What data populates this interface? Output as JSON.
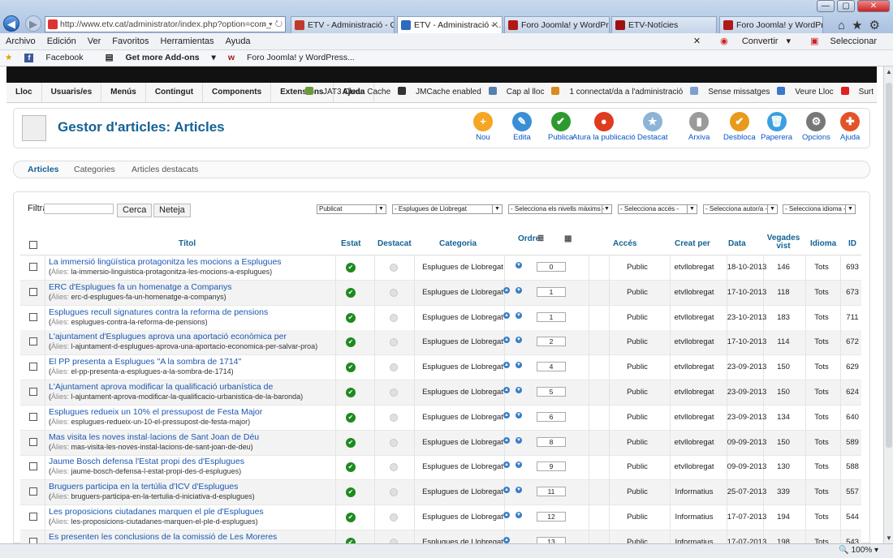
{
  "browser": {
    "address": "http://www.etv.cat/administrator/index.php?option=com_",
    "tabs": [
      {
        "label": "ETV - Administració - Ges...",
        "color": "#c0392b",
        "active": false
      },
      {
        "label": "ETV - Administració - ...",
        "color": "#2b6bc0",
        "active": true
      },
      {
        "label": "Foro Joomla! y WordPress...",
        "color": "#b01818",
        "active": false
      },
      {
        "label": "ETV-Notícies",
        "color": "#a01010",
        "active": false
      },
      {
        "label": "Foro Joomla! y WordPress...",
        "color": "#b01818",
        "active": false
      }
    ],
    "menu": [
      "Archivo",
      "Edición",
      "Ver",
      "Favoritos",
      "Herramientas",
      "Ayuda"
    ],
    "menu_right": [
      "Convertir",
      "Seleccionar"
    ],
    "favorites": [
      "Facebook",
      "Get more Add-ons",
      "Foro Joomla! y WordPress..."
    ],
    "zoom": "100%"
  },
  "admin_menu": {
    "left": [
      "Lloc",
      "Usuaris/es",
      "Menús",
      "Contingut",
      "Components",
      "Extensions",
      "Ajuda"
    ],
    "right": [
      {
        "label": "JAT3 Clean Cache",
        "color": "#6a9a3a"
      },
      {
        "label": "JMCache enabled",
        "color": "#333"
      },
      {
        "label": "Cap al lloc",
        "color": "#5580aa"
      },
      {
        "label": "1 connectat/da a l'administració",
        "color": "#d98c1c"
      },
      {
        "label": "Sense missatges",
        "color": "#7d9fd0"
      },
      {
        "label": "Veure Lloc",
        "color": "#3a78c8"
      },
      {
        "label": "Surt",
        "color": "#d22"
      }
    ]
  },
  "page_title": "Gestor d'articles: Articles",
  "toolbar": [
    {
      "label": "Nou",
      "color": "#f5a623",
      "glyph": "+",
      "icon": "plus-icon"
    },
    {
      "label": "Edita",
      "color": "#3a8ed6",
      "glyph": "✎",
      "icon": "pencil-icon"
    },
    {
      "label": "Publica",
      "color": "#2e9a2e",
      "glyph": "✔",
      "icon": "check-icon"
    },
    {
      "label": "Atura la publicació",
      "color": "#e03a1f",
      "glyph": "●",
      "icon": "stop-icon"
    },
    {
      "label": "Destacat",
      "color": "#8cb4d6",
      "glyph": "★",
      "icon": "featured-icon"
    },
    {
      "label": "Arxiva",
      "color": "#9a9a9a",
      "glyph": "▮",
      "icon": "archive-icon"
    },
    {
      "label": "Desbloca",
      "color": "#e89a1c",
      "glyph": "✔",
      "icon": "checkin-icon"
    },
    {
      "label": "Paperera",
      "color": "#3aa0e0",
      "glyph": "🗑",
      "icon": "trash-icon"
    },
    {
      "label": "Opcions",
      "color": "#777",
      "glyph": "⚙",
      "icon": "options-icon"
    },
    {
      "label": "Ajuda",
      "color": "#e2532a",
      "glyph": "✚",
      "icon": "help-icon"
    }
  ],
  "subnav": [
    "Articles",
    "Categories",
    "Articles destacats"
  ],
  "filters": {
    "label": "Filtra",
    "search_button": "Cerca",
    "clear_button": "Neteja",
    "selects": [
      "Publicat",
      "- Esplugues de Llobregat",
      "- Selecciona els nivells màxims -",
      "- Selecciona accés -",
      "- Selecciona autor/a -",
      "- Selecciona idioma -"
    ]
  },
  "table": {
    "headers": {
      "title": "Títol",
      "status": "Estat",
      "featured": "Destacat",
      "category": "Categoria",
      "order": "Ordre",
      "access": "Accés",
      "author": "Creat per",
      "date": "Data",
      "hits": "Vegades vist",
      "language": "Idioma",
      "id": "ID"
    },
    "alias_label": "Àlies:",
    "rows": [
      {
        "title": "La immersió lingüística protagonitza les mocions a Esplugues",
        "alias": "la-immersio-linguistica-protagonitza-les-mocions-a-esplugues",
        "category": "Esplugues de Llobregat",
        "order": "0",
        "access": "Public",
        "author": "etvllobregat",
        "date": "18-10-2013",
        "hits": "146",
        "language": "Tots",
        "id": "693",
        "up": false,
        "down": true
      },
      {
        "title": "ERC d'Esplugues fa un homenatge a Companys",
        "alias": "erc-d-esplugues-fa-un-homenatge-a-companys",
        "category": "Esplugues de Llobregat",
        "order": "1",
        "access": "Public",
        "author": "etvllobregat",
        "date": "17-10-2013",
        "hits": "118",
        "language": "Tots",
        "id": "673",
        "up": true,
        "down": true
      },
      {
        "title": "Esplugues recull signatures contra la reforma de pensions",
        "alias": "esplugues-contra-la-reforma-de-pensions",
        "category": "Esplugues de Llobregat",
        "order": "1",
        "access": "Public",
        "author": "etvllobregat",
        "date": "23-10-2013",
        "hits": "183",
        "language": "Tots",
        "id": "711",
        "up": true,
        "down": true
      },
      {
        "title": "L'ajuntament d'Esplugues aprova una aportació econòmica per",
        "alias": "l-ajuntament-d-esplugues-aprova-una-aportacio-economica-per-salvar-proa",
        "category": "Esplugues de Llobregat",
        "order": "2",
        "access": "Public",
        "author": "etvllobregat",
        "date": "17-10-2013",
        "hits": "114",
        "language": "Tots",
        "id": "672",
        "up": true,
        "down": true
      },
      {
        "title": "El PP presenta a Esplugues \"A la sombra de 1714\"",
        "alias": "el-pp-presenta-a-esplugues-a-la-sombra-de-1714",
        "category": "Esplugues de Llobregat",
        "order": "4",
        "access": "Public",
        "author": "etvllobregat",
        "date": "23-09-2013",
        "hits": "150",
        "language": "Tots",
        "id": "629",
        "up": true,
        "down": true
      },
      {
        "title": "L'Ajuntament aprova modificar la qualificació urbanística de",
        "alias": "l-ajuntament-aprova-modificar-la-qualificacio-urbanistica-de-la-baronda",
        "category": "Esplugues de Llobregat",
        "order": "5",
        "access": "Public",
        "author": "etvllobregat",
        "date": "23-09-2013",
        "hits": "150",
        "language": "Tots",
        "id": "624",
        "up": true,
        "down": true
      },
      {
        "title": "Esplugues redueix un 10% el pressupost de Festa Major",
        "alias": "esplugues-redueix-un-10-el-pressupost-de-festa-major",
        "category": "Esplugues de Llobregat",
        "order": "6",
        "access": "Public",
        "author": "etvllobregat",
        "date": "23-09-2013",
        "hits": "134",
        "language": "Tots",
        "id": "640",
        "up": true,
        "down": true
      },
      {
        "title": "Mas visita les noves instal·lacions de Sant Joan de Déu",
        "alias": "mas-visita-les-noves-instal-lacions-de-sant-joan-de-deu",
        "category": "Esplugues de Llobregat",
        "order": "8",
        "access": "Public",
        "author": "etvllobregat",
        "date": "09-09-2013",
        "hits": "150",
        "language": "Tots",
        "id": "589",
        "up": true,
        "down": true
      },
      {
        "title": "Jaume Bosch defensa l'Estat propi des d'Esplugues",
        "alias": "jaume-bosch-defensa-l-estat-propi-des-d-esplugues",
        "category": "Esplugues de Llobregat",
        "order": "9",
        "access": "Public",
        "author": "etvllobregat",
        "date": "09-09-2013",
        "hits": "130",
        "language": "Tots",
        "id": "588",
        "up": true,
        "down": true
      },
      {
        "title": "Bruguers participa en la tertúlia d'ICV d'Esplugues",
        "alias": "bruguers-participa-en-la-tertulia-d-iniciativa-d-esplugues",
        "category": "Esplugues de Llobregat",
        "order": "11",
        "access": "Public",
        "author": "Informatius",
        "date": "25-07-2013",
        "hits": "339",
        "language": "Tots",
        "id": "557",
        "up": true,
        "down": true
      },
      {
        "title": "Les proposicions ciutadanes marquen el ple d'Esplugues",
        "alias": "les-proposicions-ciutadanes-marquen-el-ple-d-esplugues",
        "category": "Esplugues de Llobregat",
        "order": "12",
        "access": "Public",
        "author": "Informatius",
        "date": "17-07-2013",
        "hits": "194",
        "language": "Tots",
        "id": "544",
        "up": true,
        "down": true
      },
      {
        "title": "Es presenten les conclusions de la comissió de Les Moreres",
        "alias": "",
        "category": "Esplugues de Llobregat",
        "order": "13",
        "access": "Public",
        "author": "Informatius",
        "date": "17-07-2013",
        "hits": "198",
        "language": "Tots",
        "id": "543",
        "up": true,
        "down": false
      }
    ]
  }
}
